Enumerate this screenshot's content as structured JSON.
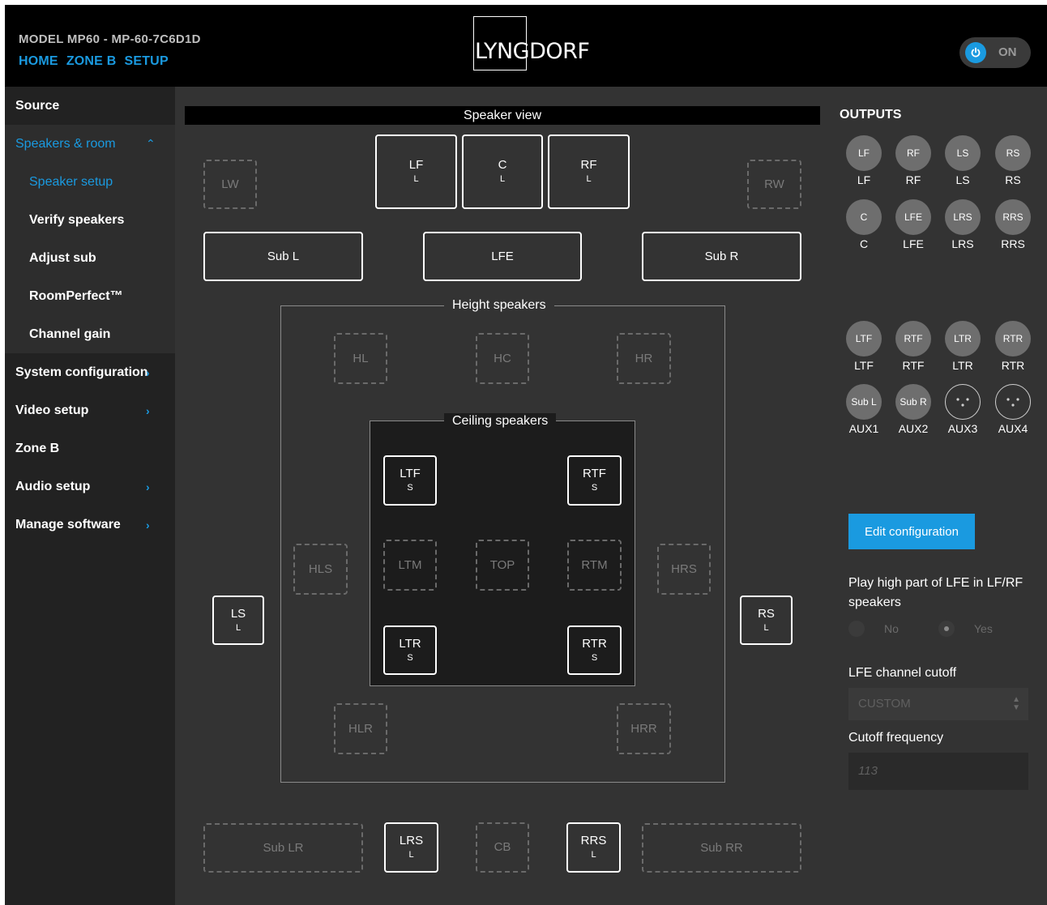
{
  "header": {
    "model": "MODEL MP60 - MP-60-7C6D1D",
    "nav": [
      "HOME",
      "ZONE B",
      "SETUP"
    ],
    "logo": "LYNGDORF",
    "power_label": "ON",
    "accent": "#1a9ae0"
  },
  "sidebar": {
    "items": [
      "Source",
      "Speakers & room",
      "Speaker setup",
      "Verify speakers",
      "Adjust sub",
      "RoomPerfect™",
      "Channel gain",
      "System configuration",
      "Video setup",
      "Zone B",
      "Audio setup",
      "Manage software"
    ]
  },
  "speaker_view": {
    "title": "Speaker view",
    "height_label": "Height speakers",
    "ceiling_label": "Ceiling speakers",
    "speakers": {
      "LW": {
        "name": "LW",
        "mode": ""
      },
      "LF": {
        "name": "LF",
        "mode": "L"
      },
      "C": {
        "name": "C",
        "mode": "L"
      },
      "RF": {
        "name": "RF",
        "mode": "L"
      },
      "RW": {
        "name": "RW",
        "mode": ""
      },
      "SubL": {
        "name": "Sub L",
        "mode": ""
      },
      "LFE": {
        "name": "LFE",
        "mode": ""
      },
      "SubR": {
        "name": "Sub R",
        "mode": ""
      },
      "HL": {
        "name": "HL",
        "mode": ""
      },
      "HC": {
        "name": "HC",
        "mode": ""
      },
      "HR": {
        "name": "HR",
        "mode": ""
      },
      "LTF": {
        "name": "LTF",
        "mode": "S"
      },
      "RTF": {
        "name": "RTF",
        "mode": "S"
      },
      "HLS": {
        "name": "HLS",
        "mode": ""
      },
      "LTM": {
        "name": "LTM",
        "mode": ""
      },
      "TOP": {
        "name": "TOP",
        "mode": ""
      },
      "RTM": {
        "name": "RTM",
        "mode": ""
      },
      "HRS": {
        "name": "HRS",
        "mode": ""
      },
      "LS": {
        "name": "LS",
        "mode": "L"
      },
      "RS": {
        "name": "RS",
        "mode": "L"
      },
      "LTR": {
        "name": "LTR",
        "mode": "S"
      },
      "RTR": {
        "name": "RTR",
        "mode": "S"
      },
      "HLR": {
        "name": "HLR",
        "mode": ""
      },
      "HRR": {
        "name": "HRR",
        "mode": ""
      },
      "SubLR": {
        "name": "Sub LR",
        "mode": ""
      },
      "LRS": {
        "name": "LRS",
        "mode": "L"
      },
      "CB": {
        "name": "CB",
        "mode": ""
      },
      "RRS": {
        "name": "RRS",
        "mode": "L"
      },
      "SubRR": {
        "name": "Sub RR",
        "mode": ""
      }
    }
  },
  "outputs": {
    "title": "OUTPUTS",
    "items": [
      {
        "channel": "LF",
        "label": "LF"
      },
      {
        "channel": "RF",
        "label": "RF"
      },
      {
        "channel": "LS",
        "label": "LS"
      },
      {
        "channel": "RS",
        "label": "RS"
      },
      {
        "channel": "C",
        "label": "C"
      },
      {
        "channel": "LFE",
        "label": "LFE"
      },
      {
        "channel": "LRS",
        "label": "LRS"
      },
      {
        "channel": "RRS",
        "label": "RRS"
      },
      {
        "channel": "LTF",
        "label": "LTF"
      },
      {
        "channel": "RTF",
        "label": "RTF"
      },
      {
        "channel": "LTR",
        "label": "LTR"
      },
      {
        "channel": "RTR",
        "label": "RTR"
      },
      {
        "channel": "Sub L",
        "label": "AUX1"
      },
      {
        "channel": "Sub R",
        "label": "AUX2"
      },
      {
        "channel": "",
        "label": "AUX3"
      },
      {
        "channel": "",
        "label": "AUX4"
      }
    ],
    "edit_button": "Edit configuration"
  },
  "settings": {
    "lfe_high_label": "Play high part of LFE in LF/RF speakers",
    "radio_no": "No",
    "radio_yes": "Yes",
    "lfe_high_selected": "Yes",
    "cutoff_label": "LFE channel cutoff",
    "cutoff_value": "CUSTOM",
    "freq_label": "Cutoff frequency",
    "freq_value": "113"
  }
}
